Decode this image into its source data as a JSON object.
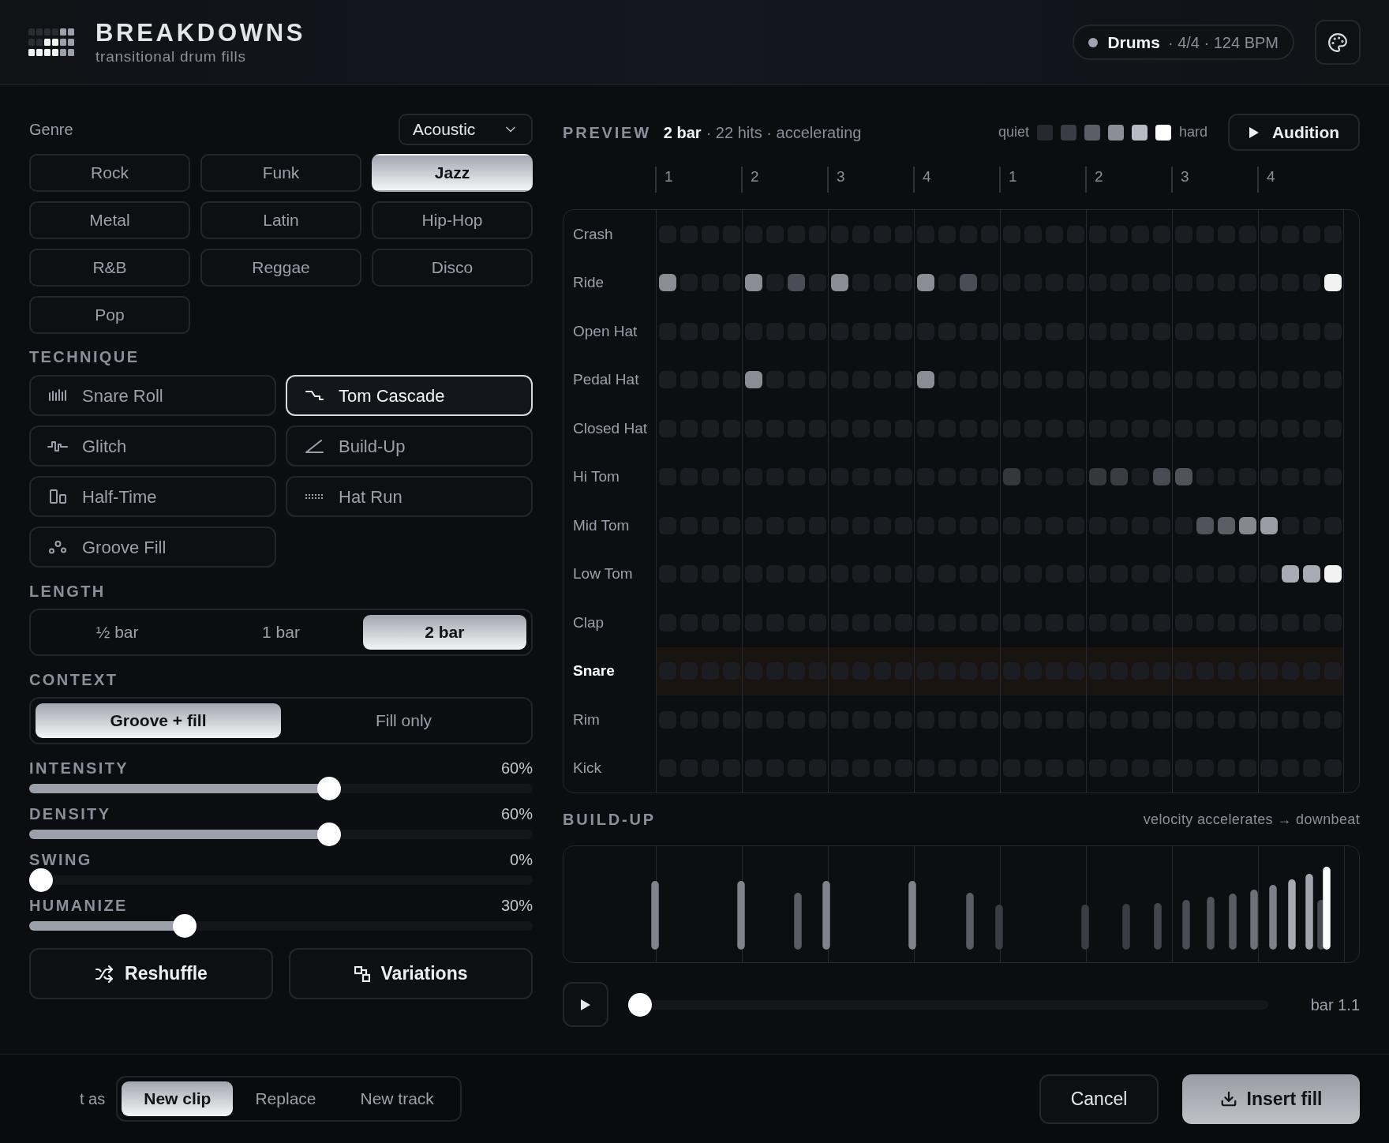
{
  "header": {
    "title": "BREAKDOWNS",
    "subtitle": "transitional drum fills",
    "track": {
      "name": "Drums",
      "meta": "· 4/4 · 124 BPM"
    }
  },
  "genre": {
    "label": "Genre",
    "kit": "Acoustic",
    "options": [
      {
        "label": "Rock",
        "selected": false
      },
      {
        "label": "Funk",
        "selected": false
      },
      {
        "label": "Jazz",
        "selected": true
      },
      {
        "label": "Metal",
        "selected": false
      },
      {
        "label": "Latin",
        "selected": false
      },
      {
        "label": "Hip-Hop",
        "selected": false
      },
      {
        "label": "R&B",
        "selected": false
      },
      {
        "label": "Reggae",
        "selected": false
      },
      {
        "label": "Disco",
        "selected": false
      },
      {
        "label": "Pop",
        "selected": false
      }
    ]
  },
  "technique": {
    "label": "TECHNIQUE",
    "options": [
      {
        "label": "Snare Roll",
        "selected": false
      },
      {
        "label": "Tom Cascade",
        "selected": true
      },
      {
        "label": "Glitch",
        "selected": false
      },
      {
        "label": "Build-Up",
        "selected": false
      },
      {
        "label": "Half-Time",
        "selected": false
      },
      {
        "label": "Hat Run",
        "selected": false
      },
      {
        "label": "Groove Fill",
        "selected": false
      }
    ]
  },
  "length": {
    "label": "LENGTH",
    "options": [
      {
        "label": "½ bar",
        "selected": false
      },
      {
        "label": "1 bar",
        "selected": false
      },
      {
        "label": "2 bar",
        "selected": true
      }
    ]
  },
  "context": {
    "label": "CONTEXT",
    "options": [
      {
        "label": "Groove + fill",
        "selected": true
      },
      {
        "label": "Fill only",
        "selected": false
      }
    ]
  },
  "sliders": [
    {
      "label": "INTENSITY",
      "reading": "60%",
      "level": 0.6
    },
    {
      "label": "DENSITY",
      "reading": "60%",
      "level": 0.6
    },
    {
      "label": "SWING",
      "reading": "0%",
      "level": 0
    },
    {
      "label": "HUMANIZE",
      "reading": "30%",
      "level": 0.3
    }
  ],
  "actions": [
    {
      "label": "Reshuffle"
    },
    {
      "label": "Variations"
    }
  ],
  "preview": {
    "label": "PREVIEW",
    "length": "2 bar",
    "summary": "· 22 hits · accelerating",
    "legend": {
      "low": "quiet",
      "high": "hard",
      "swatches": [
        {
          "color": "#262930"
        },
        {
          "color": "#3a3d45"
        },
        {
          "color": "#5b5e67"
        },
        {
          "color": "#8b8e97"
        },
        {
          "color": "#b8bbc4"
        },
        {
          "color": "#ffffff"
        }
      ]
    },
    "audition": "Audition",
    "beats": [
      "1",
      "2",
      "3",
      "4",
      "1",
      "2",
      "3",
      "4"
    ],
    "rows": [
      {
        "name": "Crash",
        "selected": false,
        "cells": [
          {
            "on": false
          },
          {
            "on": false
          },
          {
            "on": false
          },
          {
            "on": false
          },
          {
            "on": false
          },
          {
            "on": false
          },
          {
            "on": false
          },
          {
            "on": false
          },
          {
            "on": false
          },
          {
            "on": false
          },
          {
            "on": false
          },
          {
            "on": false
          },
          {
            "on": false
          },
          {
            "on": false
          },
          {
            "on": false
          },
          {
            "on": false
          },
          {
            "on": false
          },
          {
            "on": false
          },
          {
            "on": false
          },
          {
            "on": false
          },
          {
            "on": false
          },
          {
            "on": false
          },
          {
            "on": false
          },
          {
            "on": false
          },
          {
            "on": false
          },
          {
            "on": false
          },
          {
            "on": false
          },
          {
            "on": false
          },
          {
            "on": false
          },
          {
            "on": false
          },
          {
            "on": false
          },
          {
            "on": false
          }
        ]
      },
      {
        "name": "Ride",
        "selected": false,
        "cells": [
          {
            "on": true,
            "color": "#8a8d94"
          },
          {
            "on": false
          },
          {
            "on": false
          },
          {
            "on": false
          },
          {
            "on": true,
            "color": "#8a8d94"
          },
          {
            "on": false
          },
          {
            "on": true,
            "color": "#4a4d55"
          },
          {
            "on": false
          },
          {
            "on": true,
            "color": "#8a8d94"
          },
          {
            "on": false
          },
          {
            "on": false
          },
          {
            "on": false
          },
          {
            "on": true,
            "color": "#8a8d94"
          },
          {
            "on": false
          },
          {
            "on": true,
            "color": "#4a4d55"
          },
          {
            "on": false
          },
          {
            "on": false
          },
          {
            "on": false
          },
          {
            "on": false
          },
          {
            "on": false
          },
          {
            "on": false
          },
          {
            "on": false
          },
          {
            "on": false
          },
          {
            "on": false
          },
          {
            "on": false
          },
          {
            "on": false
          },
          {
            "on": false
          },
          {
            "on": false
          },
          {
            "on": false
          },
          {
            "on": false
          },
          {
            "on": false
          },
          {
            "on": true,
            "color": "#f2f2f2"
          }
        ]
      },
      {
        "name": "Open Hat",
        "selected": false,
        "cells": [
          {
            "on": false
          },
          {
            "on": false
          },
          {
            "on": false
          },
          {
            "on": false
          },
          {
            "on": false
          },
          {
            "on": false
          },
          {
            "on": false
          },
          {
            "on": false
          },
          {
            "on": false
          },
          {
            "on": false
          },
          {
            "on": false
          },
          {
            "on": false
          },
          {
            "on": false
          },
          {
            "on": false
          },
          {
            "on": false
          },
          {
            "on": false
          },
          {
            "on": false
          },
          {
            "on": false
          },
          {
            "on": false
          },
          {
            "on": false
          },
          {
            "on": false
          },
          {
            "on": false
          },
          {
            "on": false
          },
          {
            "on": false
          },
          {
            "on": false
          },
          {
            "on": false
          },
          {
            "on": false
          },
          {
            "on": false
          },
          {
            "on": false
          },
          {
            "on": false
          },
          {
            "on": false
          },
          {
            "on": false
          }
        ]
      },
      {
        "name": "Pedal Hat",
        "selected": false,
        "cells": [
          {
            "on": false
          },
          {
            "on": false
          },
          {
            "on": false
          },
          {
            "on": false
          },
          {
            "on": true,
            "color": "#8a8d94"
          },
          {
            "on": false
          },
          {
            "on": false
          },
          {
            "on": false
          },
          {
            "on": false
          },
          {
            "on": false
          },
          {
            "on": false
          },
          {
            "on": false
          },
          {
            "on": true,
            "color": "#8a8d94"
          },
          {
            "on": false
          },
          {
            "on": false
          },
          {
            "on": false
          },
          {
            "on": false
          },
          {
            "on": false
          },
          {
            "on": false
          },
          {
            "on": false
          },
          {
            "on": false
          },
          {
            "on": false
          },
          {
            "on": false
          },
          {
            "on": false
          },
          {
            "on": false
          },
          {
            "on": false
          },
          {
            "on": false
          },
          {
            "on": false
          },
          {
            "on": false
          },
          {
            "on": false
          },
          {
            "on": false
          },
          {
            "on": false
          }
        ]
      },
      {
        "name": "Closed Hat",
        "selected": false,
        "cells": [
          {
            "on": false
          },
          {
            "on": false
          },
          {
            "on": false
          },
          {
            "on": false
          },
          {
            "on": false
          },
          {
            "on": false
          },
          {
            "on": false
          },
          {
            "on": false
          },
          {
            "on": false
          },
          {
            "on": false
          },
          {
            "on": false
          },
          {
            "on": false
          },
          {
            "on": false
          },
          {
            "on": false
          },
          {
            "on": false
          },
          {
            "on": false
          },
          {
            "on": false
          },
          {
            "on": false
          },
          {
            "on": false
          },
          {
            "on": false
          },
          {
            "on": false
          },
          {
            "on": false
          },
          {
            "on": false
          },
          {
            "on": false
          },
          {
            "on": false
          },
          {
            "on": false
          },
          {
            "on": false
          },
          {
            "on": false
          },
          {
            "on": false
          },
          {
            "on": false
          },
          {
            "on": false
          },
          {
            "on": false
          }
        ]
      },
      {
        "name": "Hi Tom",
        "selected": false,
        "cells": [
          {
            "on": false
          },
          {
            "on": false
          },
          {
            "on": false
          },
          {
            "on": false
          },
          {
            "on": false
          },
          {
            "on": false
          },
          {
            "on": false
          },
          {
            "on": false
          },
          {
            "on": false
          },
          {
            "on": false
          },
          {
            "on": false
          },
          {
            "on": false
          },
          {
            "on": false
          },
          {
            "on": false
          },
          {
            "on": false
          },
          {
            "on": false
          },
          {
            "on": true,
            "color": "#35373d"
          },
          {
            "on": false
          },
          {
            "on": false
          },
          {
            "on": false
          },
          {
            "on": true,
            "color": "#35373d"
          },
          {
            "on": true,
            "color": "#3a3c42"
          },
          {
            "on": false
          },
          {
            "on": true,
            "color": "#4a4c53"
          },
          {
            "on": true,
            "color": "#51535a"
          },
          {
            "on": false
          },
          {
            "on": false
          },
          {
            "on": false
          },
          {
            "on": false
          },
          {
            "on": false
          },
          {
            "on": false
          },
          {
            "on": false
          }
        ]
      },
      {
        "name": "Mid Tom",
        "selected": false,
        "cells": [
          {
            "on": false
          },
          {
            "on": false
          },
          {
            "on": false
          },
          {
            "on": false
          },
          {
            "on": false
          },
          {
            "on": false
          },
          {
            "on": false
          },
          {
            "on": false
          },
          {
            "on": false
          },
          {
            "on": false
          },
          {
            "on": false
          },
          {
            "on": false
          },
          {
            "on": false
          },
          {
            "on": false
          },
          {
            "on": false
          },
          {
            "on": false
          },
          {
            "on": false
          },
          {
            "on": false
          },
          {
            "on": false
          },
          {
            "on": false
          },
          {
            "on": false
          },
          {
            "on": false
          },
          {
            "on": false
          },
          {
            "on": false
          },
          {
            "on": false
          },
          {
            "on": true,
            "color": "#51535a"
          },
          {
            "on": true,
            "color": "#5b5e65"
          },
          {
            "on": true,
            "color": "#85888f"
          },
          {
            "on": true,
            "color": "#9a9da4"
          },
          {
            "on": false
          },
          {
            "on": false
          },
          {
            "on": false
          }
        ]
      },
      {
        "name": "Low Tom",
        "selected": false,
        "cells": [
          {
            "on": false
          },
          {
            "on": false
          },
          {
            "on": false
          },
          {
            "on": false
          },
          {
            "on": false
          },
          {
            "on": false
          },
          {
            "on": false
          },
          {
            "on": false
          },
          {
            "on": false
          },
          {
            "on": false
          },
          {
            "on": false
          },
          {
            "on": false
          },
          {
            "on": false
          },
          {
            "on": false
          },
          {
            "on": false
          },
          {
            "on": false
          },
          {
            "on": false
          },
          {
            "on": false
          },
          {
            "on": false
          },
          {
            "on": false
          },
          {
            "on": false
          },
          {
            "on": false
          },
          {
            "on": false
          },
          {
            "on": false
          },
          {
            "on": false
          },
          {
            "on": false
          },
          {
            "on": false
          },
          {
            "on": false
          },
          {
            "on": false
          },
          {
            "on": true,
            "color": "#a8abb3"
          },
          {
            "on": true,
            "color": "#a8abb3"
          },
          {
            "on": true,
            "color": "#f2f2f2"
          }
        ]
      },
      {
        "name": "Clap",
        "selected": false,
        "cells": [
          {
            "on": false
          },
          {
            "on": false
          },
          {
            "on": false
          },
          {
            "on": false
          },
          {
            "on": false
          },
          {
            "on": false
          },
          {
            "on": false
          },
          {
            "on": false
          },
          {
            "on": false
          },
          {
            "on": false
          },
          {
            "on": false
          },
          {
            "on": false
          },
          {
            "on": false
          },
          {
            "on": false
          },
          {
            "on": false
          },
          {
            "on": false
          },
          {
            "on": false
          },
          {
            "on": false
          },
          {
            "on": false
          },
          {
            "on": false
          },
          {
            "on": false
          },
          {
            "on": false
          },
          {
            "on": false
          },
          {
            "on": false
          },
          {
            "on": false
          },
          {
            "on": false
          },
          {
            "on": false
          },
          {
            "on": false
          },
          {
            "on": false
          },
          {
            "on": false
          },
          {
            "on": false
          },
          {
            "on": false
          }
        ]
      },
      {
        "name": "Snare",
        "selected": true,
        "cells": [
          {
            "on": false
          },
          {
            "on": false
          },
          {
            "on": false
          },
          {
            "on": false
          },
          {
            "on": false
          },
          {
            "on": false
          },
          {
            "on": false
          },
          {
            "on": false
          },
          {
            "on": false
          },
          {
            "on": false
          },
          {
            "on": false
          },
          {
            "on": false
          },
          {
            "on": false
          },
          {
            "on": false
          },
          {
            "on": false
          },
          {
            "on": false
          },
          {
            "on": false
          },
          {
            "on": false
          },
          {
            "on": false
          },
          {
            "on": false
          },
          {
            "on": false
          },
          {
            "on": false
          },
          {
            "on": false
          },
          {
            "on": false
          },
          {
            "on": false
          },
          {
            "on": false
          },
          {
            "on": false
          },
          {
            "on": false
          },
          {
            "on": false
          },
          {
            "on": false
          },
          {
            "on": false
          },
          {
            "on": false
          }
        ]
      },
      {
        "name": "Rim",
        "selected": false,
        "cells": [
          {
            "on": false
          },
          {
            "on": false
          },
          {
            "on": false
          },
          {
            "on": false
          },
          {
            "on": false
          },
          {
            "on": false
          },
          {
            "on": false
          },
          {
            "on": false
          },
          {
            "on": false
          },
          {
            "on": false
          },
          {
            "on": false
          },
          {
            "on": false
          },
          {
            "on": false
          },
          {
            "on": false
          },
          {
            "on": false
          },
          {
            "on": false
          },
          {
            "on": false
          },
          {
            "on": false
          },
          {
            "on": false
          },
          {
            "on": false
          },
          {
            "on": false
          },
          {
            "on": false
          },
          {
            "on": false
          },
          {
            "on": false
          },
          {
            "on": false
          },
          {
            "on": false
          },
          {
            "on": false
          },
          {
            "on": false
          },
          {
            "on": false
          },
          {
            "on": false
          },
          {
            "on": false
          },
          {
            "on": false
          }
        ]
      },
      {
        "name": "Kick",
        "selected": false,
        "cells": [
          {
            "on": false
          },
          {
            "on": false
          },
          {
            "on": false
          },
          {
            "on": false
          },
          {
            "on": false
          },
          {
            "on": false
          },
          {
            "on": false
          },
          {
            "on": false
          },
          {
            "on": false
          },
          {
            "on": false
          },
          {
            "on": false
          },
          {
            "on": false
          },
          {
            "on": false
          },
          {
            "on": false
          },
          {
            "on": false
          },
          {
            "on": false
          },
          {
            "on": false
          },
          {
            "on": false
          },
          {
            "on": false
          },
          {
            "on": false
          },
          {
            "on": false
          },
          {
            "on": false
          },
          {
            "on": false
          },
          {
            "on": false
          },
          {
            "on": false
          },
          {
            "on": false
          },
          {
            "on": false
          },
          {
            "on": false
          },
          {
            "on": false
          },
          {
            "on": false
          },
          {
            "on": false
          },
          {
            "on": false
          }
        ]
      }
    ]
  },
  "buildup": {
    "label": "BUILD-UP",
    "note": "velocity accelerates → downbeat"
  },
  "transport": {
    "level": 0,
    "position": "bar 1.1"
  },
  "footer": {
    "label": "t as",
    "modes": [
      {
        "label": "New clip",
        "selected": true
      },
      {
        "label": "Replace",
        "selected": false
      },
      {
        "label": "New track",
        "selected": false
      }
    ],
    "cancel": "Cancel",
    "confirm": "Insert fill"
  }
}
